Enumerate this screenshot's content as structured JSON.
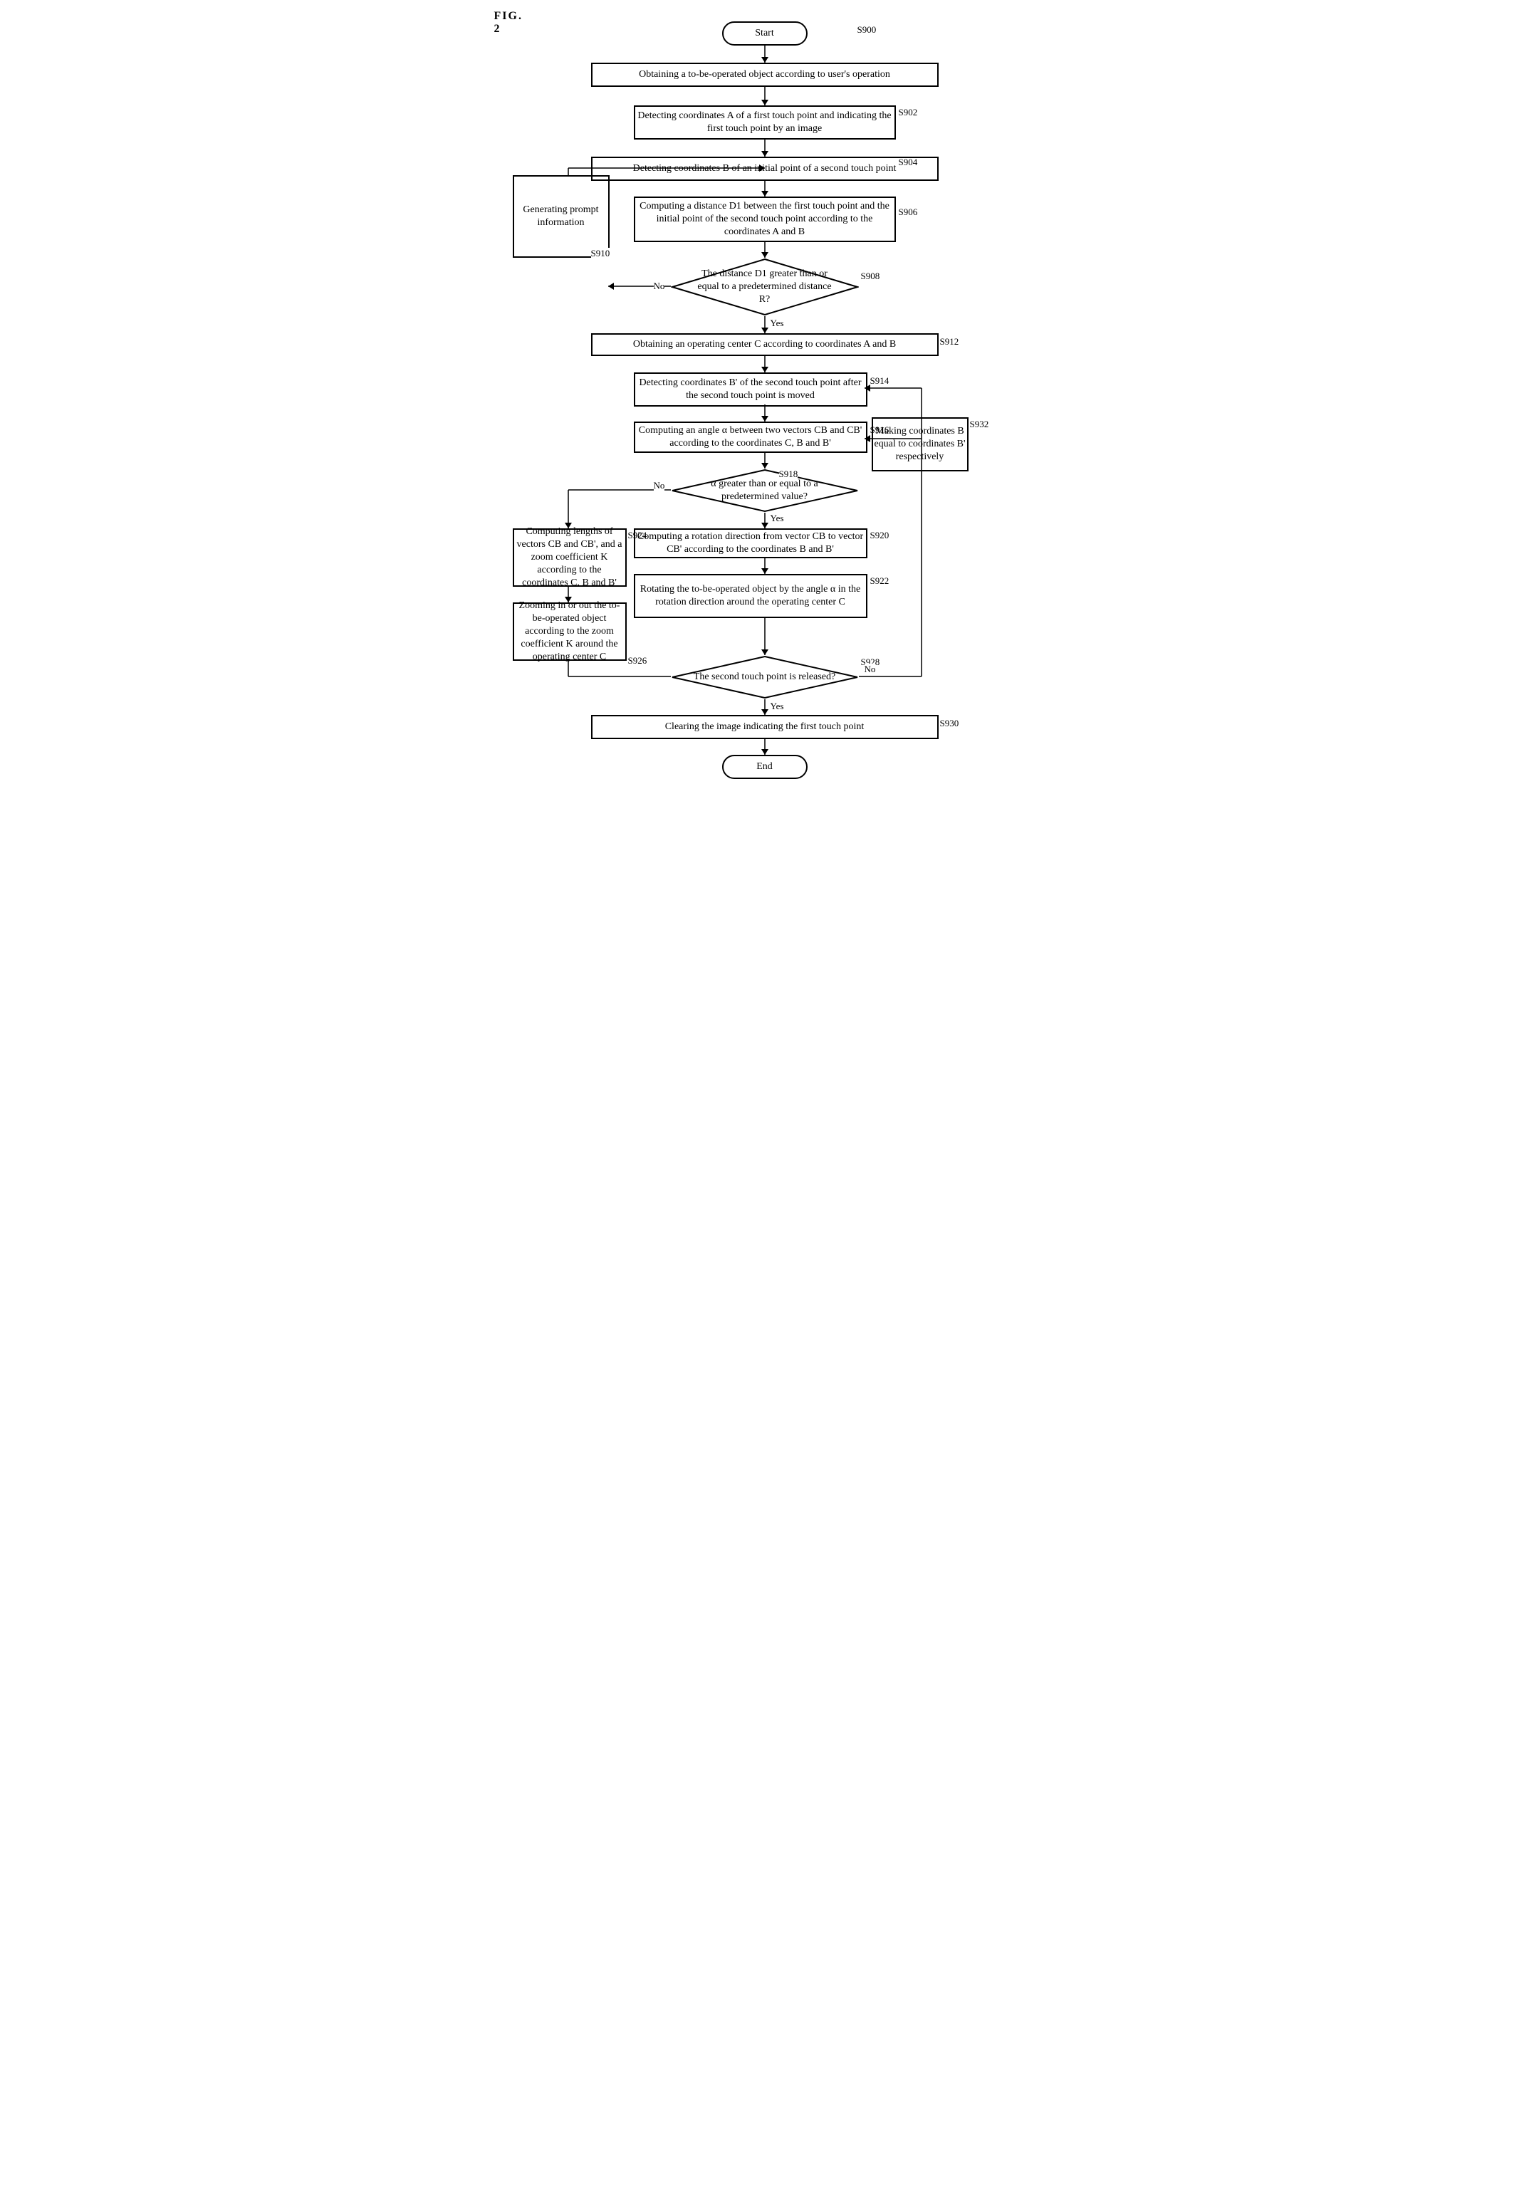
{
  "diagram": {
    "title": "FIG. 2",
    "shapes": {
      "start": {
        "label": "Start",
        "type": "rounded-rect"
      },
      "s900": {
        "label": "S900"
      },
      "s901": {
        "label": "Obtaining a to-be-operated object according to user's operation",
        "type": "rect"
      },
      "s902": {
        "label": "S902"
      },
      "s902box": {
        "label": "Detecting coordinates A of a first touch point and indicating the first touch point by an image",
        "type": "rect"
      },
      "s904": {
        "label": "S904"
      },
      "s904box": {
        "label": "Detecting coordinates B of an initial point  of a second touch point",
        "type": "rect"
      },
      "s906": {
        "label": "S906"
      },
      "s906box": {
        "label": "Computing a distance D1 between the first touch point and the initial point of the second touch point according to the coordinates A and B",
        "type": "rect"
      },
      "s908": {
        "label": "S908"
      },
      "s908diamond": {
        "label": "The distance D1 greater than or equal to a predetermined distance R?",
        "type": "diamond"
      },
      "s910": {
        "label": "S910"
      },
      "genprompt": {
        "label": "Generating prompt information",
        "type": "rect"
      },
      "no_s908": {
        "label": "No"
      },
      "yes_s908": {
        "label": "Yes"
      },
      "s912": {
        "label": "S912"
      },
      "s912box": {
        "label": "Obtaining an operating center C according to coordinates A and B",
        "type": "rect"
      },
      "s914": {
        "label": "S914"
      },
      "s914box": {
        "label": "Detecting coordinates B' of the second touch point after the second touch point is moved",
        "type": "rect"
      },
      "s916": {
        "label": "S916"
      },
      "s916box": {
        "label": "Computing an angle α between two vectors CB and CB' according to the coordinates C, B and B'",
        "type": "rect"
      },
      "s918": {
        "label": "S918"
      },
      "s918diamond": {
        "label": "α greater than or equal to a predetermined value?",
        "type": "diamond"
      },
      "s920": {
        "label": "S920"
      },
      "s920box": {
        "label": "Computing a rotation direction from vector CB to vector CB' according to the coordinates B and B'",
        "type": "rect"
      },
      "s922": {
        "label": "S922"
      },
      "s922box": {
        "label": "Rotating the to-be-operated object by the angle α in the rotation direction around the operating center C",
        "type": "rect"
      },
      "s924": {
        "label": "S924"
      },
      "s924box": {
        "label": "Computing lengths of vectors CB and CB', and a zoom coefficient K according to the coordinates C, B and B'",
        "type": "rect"
      },
      "s926": {
        "label": "S926"
      },
      "s926box": {
        "label": "Zooming in or out the to-be-operated object according to the zoom coefficient K around the operating center C",
        "type": "rect"
      },
      "s928": {
        "label": "S928"
      },
      "s928diamond": {
        "label": "The second touch point is released?",
        "type": "diamond"
      },
      "s930": {
        "label": "S930"
      },
      "s930box": {
        "label": "Clearing the image indicating the first touch point",
        "type": "rect"
      },
      "s932": {
        "label": "S932"
      },
      "s932box": {
        "label": "Making coordinates B equal to coordinates B' respectively",
        "type": "rect"
      },
      "no_s918": {
        "label": "No"
      },
      "yes_s918": {
        "label": "Yes"
      },
      "no_s928": {
        "label": "No"
      },
      "yes_s928": {
        "label": "Yes"
      },
      "end": {
        "label": "End",
        "type": "rounded-rect"
      }
    }
  }
}
